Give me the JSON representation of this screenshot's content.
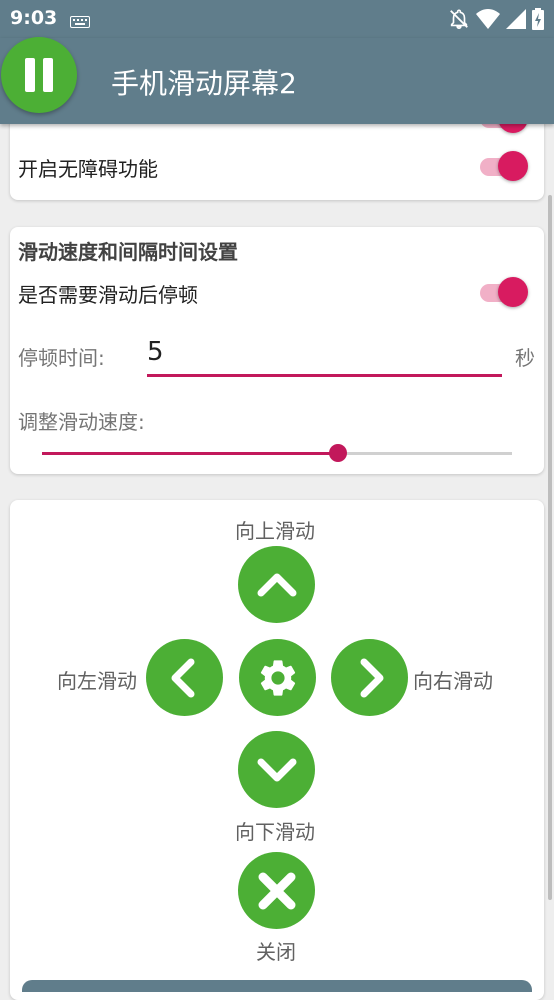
{
  "status_bar": {
    "time": "9:03",
    "icons": [
      "keyboard-icon",
      "notifications-off-icon",
      "wifi-icon",
      "signal-icon",
      "battery-charging-icon"
    ]
  },
  "app_bar": {
    "title": "手机滑动屏幕2",
    "pause_icon": "pause-icon",
    "background": "#607d8b"
  },
  "accessibility_card": {
    "label": "开启无障碍功能",
    "enabled": true
  },
  "speed_card": {
    "title": "滑动速度和间隔时间设置",
    "pause_after_swipe_label": "是否需要滑动后停顿",
    "pause_after_swipe_enabled": true,
    "pause_time_label": "停顿时间:",
    "pause_time_value": "5",
    "pause_time_unit": "秒",
    "speed_label": "调整滑动速度:",
    "speed_fraction": 0.63
  },
  "controls": {
    "up_label": "向上滑动",
    "left_label": "向左滑动",
    "right_label": "向右滑动",
    "down_label": "向下滑动",
    "close_label": "关闭"
  },
  "colors": {
    "accent": "#d81b60",
    "button_green": "#4caf35"
  }
}
